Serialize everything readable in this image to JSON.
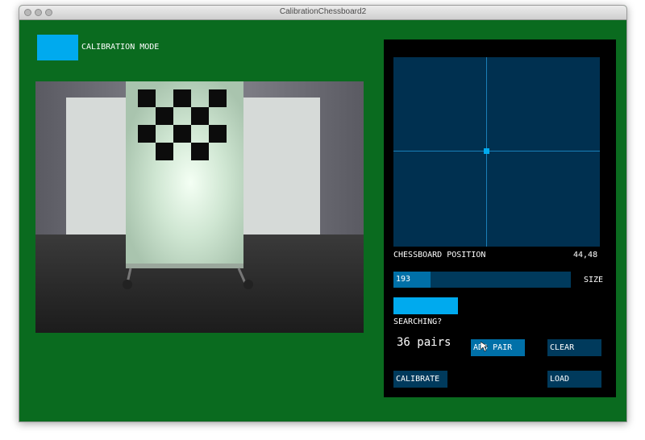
{
  "window": {
    "title": "CalibrationChessboard2"
  },
  "mode": {
    "label": "CALIBRATION MODE",
    "swatch_color": "#00aaee"
  },
  "camera": {
    "description_icon": "camera-feed-image"
  },
  "position": {
    "label": "CHESSBOARD POSITION",
    "value": "44,48"
  },
  "size": {
    "label": "SIZE",
    "value": "193",
    "fill_fraction": 0.21
  },
  "searching": {
    "label": "SEARCHING?"
  },
  "pairs": {
    "text": "36 pairs"
  },
  "buttons": {
    "add_pair": "ADD PAIR",
    "clear": "CLEAR",
    "calibrate": "CALIBRATE",
    "load": "LOAD"
  },
  "colors": {
    "background": "#0a6b1f",
    "panel": "#000000",
    "plot": "#003050",
    "accent": "#00aaee",
    "button": "#003a5c",
    "button_active": "#0070a8"
  }
}
